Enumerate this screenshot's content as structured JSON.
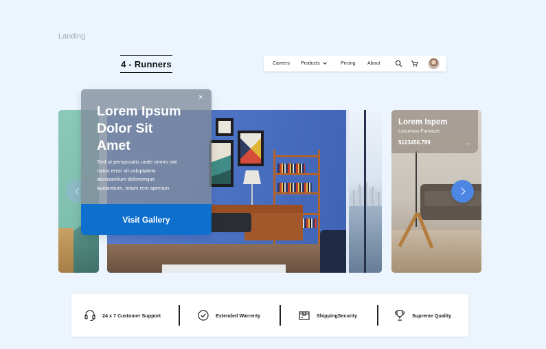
{
  "page_label": "Landing",
  "brand": {
    "logo_text": "4 - Runners"
  },
  "nav": {
    "links": [
      "Careers",
      "Products",
      "Pricing",
      "About"
    ],
    "icons": [
      "search-icon",
      "cart-icon"
    ],
    "avatar": "user-avatar"
  },
  "hero": {
    "title": "Lorem Ipsum\nDolor Sit\nAmet",
    "description": "Sed ut perspiciatis unde omnis iste\nnatus error sit voluptatem\naccusantium doloremque\nlaudantium, totam rem aperiam",
    "cta_label": "Visit Gallery",
    "close_glyph": "×"
  },
  "side_card": {
    "title": "Lorem Ispem",
    "subtitle": "Luxurious Furniture",
    "price": "$123456.789",
    "arrow_glyph": "→"
  },
  "features": [
    {
      "label": "24 x 7 Customer Support",
      "icon": "headset-icon"
    },
    {
      "label": "Extended Warrenty",
      "icon": "check-circle-icon"
    },
    {
      "label": "ShippingSecurity",
      "icon": "shipping-box-icon"
    },
    {
      "label": "Supreme Quality",
      "icon": "trophy-icon"
    }
  ],
  "colors": {
    "background": "#ecf5fd",
    "primary": "#0f6fcc",
    "carousel_next": "#4e86e3"
  }
}
